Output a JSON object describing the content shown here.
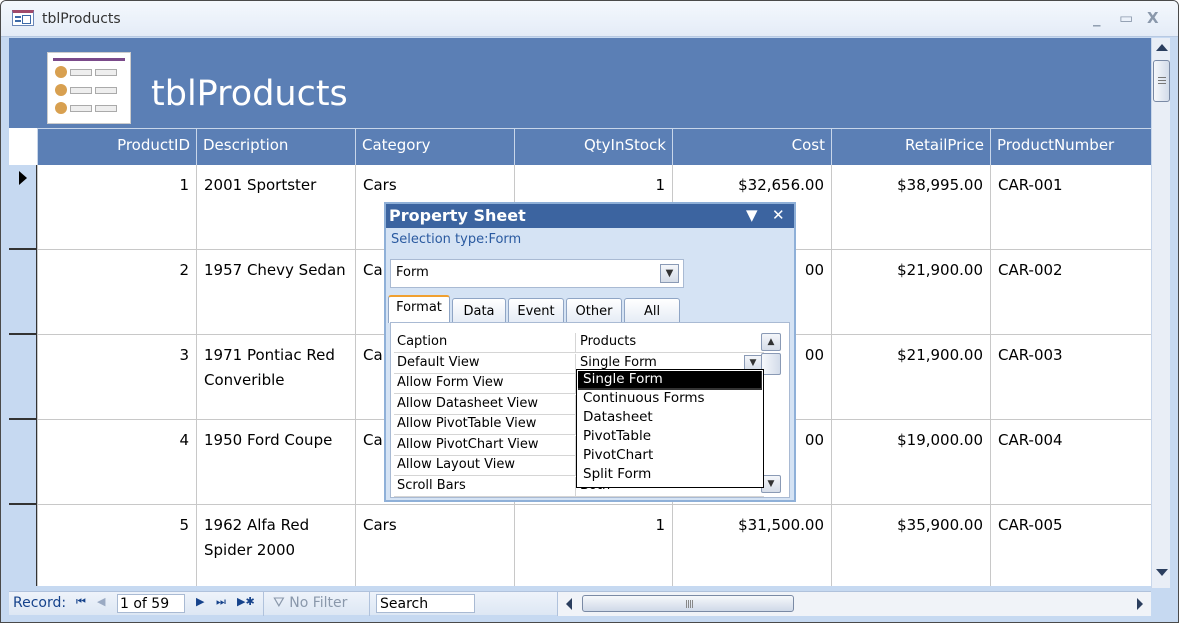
{
  "window": {
    "title": "tblProducts",
    "controls": {
      "minimize": "_",
      "maximize": "▭",
      "close": "X"
    }
  },
  "form_header": {
    "title": "tblProducts",
    "logo_icon": "form-logo-icon"
  },
  "columns": [
    {
      "label": "ProductID",
      "align": "right"
    },
    {
      "label": "Description",
      "align": "left"
    },
    {
      "label": "Category",
      "align": "left"
    },
    {
      "label": "QtyInStock",
      "align": "right"
    },
    {
      "label": "Cost",
      "align": "right"
    },
    {
      "label": "RetailPrice",
      "align": "right"
    },
    {
      "label": "ProductNumber",
      "align": "left"
    }
  ],
  "rows": [
    {
      "product_id": "1",
      "description": "2001 Sportster",
      "category": "Cars",
      "qty": "1",
      "cost": "$32,656.00",
      "retail": "$38,995.00",
      "number": "CAR-001",
      "current": true
    },
    {
      "product_id": "2",
      "description": "1957 Chevy Sedan",
      "category": "Ca",
      "qty": "",
      "cost": "00",
      "retail": "$21,900.00",
      "number": "CAR-002"
    },
    {
      "product_id": "3",
      "description": "1971 Pontiac Red Converible",
      "category": "Ca",
      "qty": "",
      "cost": "00",
      "retail": "$21,900.00",
      "number": "CAR-003"
    },
    {
      "product_id": "4",
      "description": "1950 Ford Coupe",
      "category": "Ca",
      "qty": "",
      "cost": "00",
      "retail": "$19,000.00",
      "number": "CAR-004"
    },
    {
      "product_id": "5",
      "description": "1962 Alfa Red Spider 2000",
      "category": "Cars",
      "qty": "1",
      "cost": "$31,500.00",
      "retail": "$35,900.00",
      "number": "CAR-005"
    }
  ],
  "navigation": {
    "label": "Record:",
    "first": "⏮",
    "prev": "◀",
    "record_value": "1 of 59",
    "next": "▶",
    "last": "⏭",
    "new": "▶✱",
    "filter_label": "No Filter",
    "search_value": "Search"
  },
  "property_sheet": {
    "title": "Property Sheet",
    "menu_icon": "▼",
    "close_icon": "✕",
    "selection_type": "Selection type:Form",
    "selected_object": "Form",
    "tabs": [
      "Format",
      "Data",
      "Event",
      "Other",
      "All"
    ],
    "active_tab": "Format",
    "properties": [
      {
        "name": "Caption",
        "value": "Products"
      },
      {
        "name": "Default View",
        "value": "Single Form"
      },
      {
        "name": "Allow Form View",
        "value": ""
      },
      {
        "name": "Allow Datasheet View",
        "value": ""
      },
      {
        "name": "Allow PivotTable View",
        "value": ""
      },
      {
        "name": "Allow PivotChart View",
        "value": ""
      },
      {
        "name": "Allow Layout View",
        "value": ""
      },
      {
        "name": "Scroll Bars",
        "value": "Both"
      }
    ],
    "dropdown_options": [
      "Single Form",
      "Continuous Forms",
      "Datasheet",
      "PivotTable",
      "PivotChart",
      "Split Form"
    ],
    "dropdown_selected": "Single Form"
  }
}
